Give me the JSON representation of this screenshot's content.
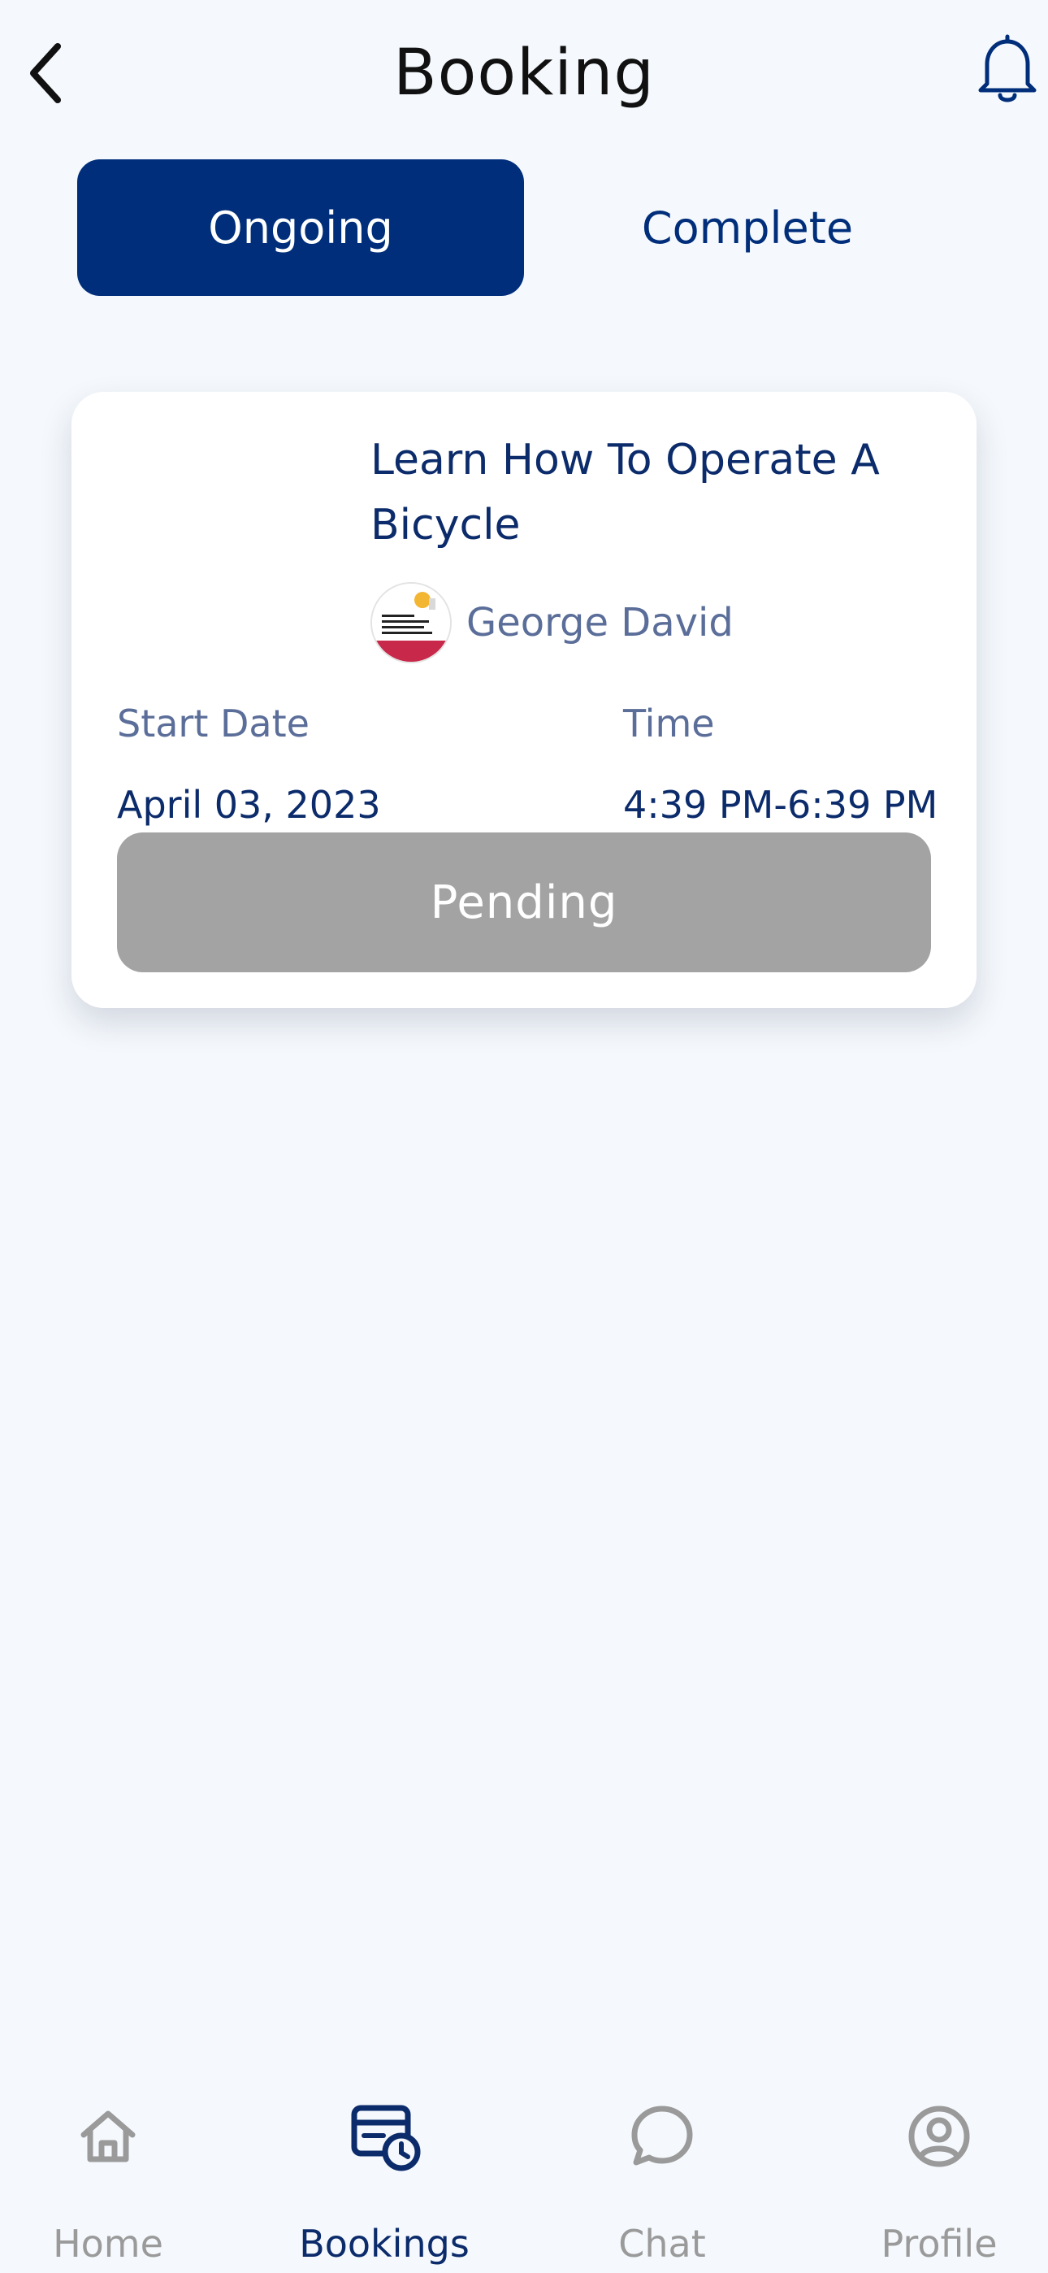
{
  "header": {
    "title": "Booking",
    "back_icon": "chevron-left-icon",
    "bell_icon": "bell-icon"
  },
  "tabs": [
    {
      "label": "Ongoing",
      "active": true
    },
    {
      "label": "Complete",
      "active": false
    }
  ],
  "booking_card": {
    "course_title": "Learn How To Operate A Bicycle",
    "instructor": {
      "name": "George David",
      "avatar_icon": "avatar-image"
    },
    "start_date_label": "Start Date",
    "start_date_value": "April 03, 2023",
    "time_label": "Time",
    "time_value": "4:39 PM-6:39 PM",
    "status_label": "Pending"
  },
  "bottom_nav": {
    "items": [
      {
        "label": "Home",
        "icon": "home-icon",
        "active": false
      },
      {
        "label": "Bookings",
        "icon": "calendar-clock-icon",
        "active": true
      },
      {
        "label": "Chat",
        "icon": "chat-bubble-icon",
        "active": false
      },
      {
        "label": "Profile",
        "icon": "user-circle-icon",
        "active": false
      }
    ]
  },
  "colors": {
    "background": "#f5f9fd",
    "primary": "#002e7a",
    "text_primary": "#0b2b6b",
    "text_secondary": "#5b6e99",
    "pending_gray": "#a3a3a3",
    "inactive_nav": "#9a9a9a"
  }
}
